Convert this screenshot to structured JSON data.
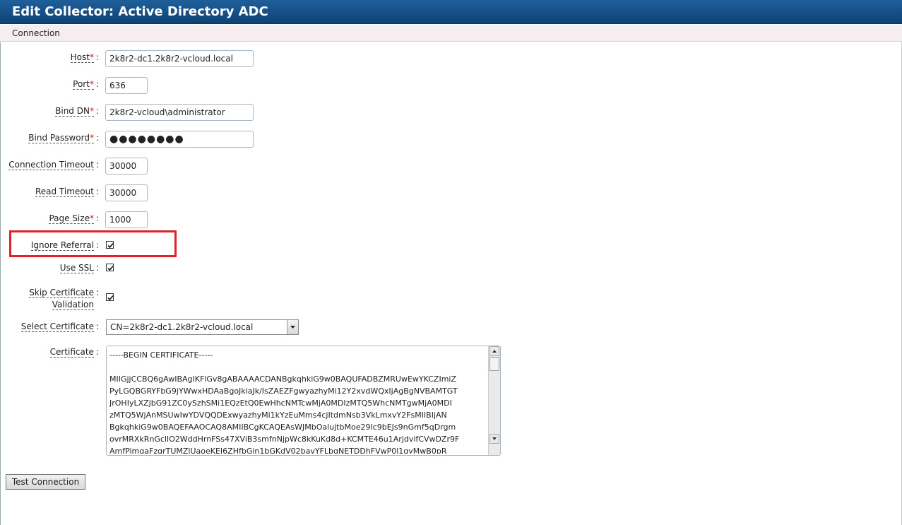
{
  "window": {
    "title": "Edit Collector: Active Directory ADC"
  },
  "tabs": [
    {
      "label": "Connection"
    }
  ],
  "form": {
    "host": {
      "label": "Host",
      "value": "2k8r2-dc1.2k8r2-vcloud.local"
    },
    "port": {
      "label": "Port",
      "value": "636"
    },
    "bind_dn": {
      "label": "Bind DN",
      "value": "2k8r2-vcloud\\administrator"
    },
    "bind_password": {
      "label": "Bind Password",
      "value": "●●●●●●●●"
    },
    "connection_timeout": {
      "label": "Connection Timeout",
      "value": "30000"
    },
    "read_timeout": {
      "label": "Read Timeout",
      "value": "30000"
    },
    "page_size": {
      "label": "Page Size",
      "value": "1000"
    },
    "ignore_referral": {
      "label": "Ignore Referral",
      "checked": true
    },
    "use_ssl": {
      "label": "Use SSL",
      "checked": true
    },
    "skip_cert_validation": {
      "label_line1": "Skip Certificate",
      "label_line2": "Validation",
      "checked": true
    },
    "select_certificate": {
      "label": "Select Certificate",
      "value": "CN=2k8r2-dc1.2k8r2-vcloud.local"
    },
    "certificate": {
      "label": "Certificate",
      "value": "-----BEGIN CERTIFICATE-----\n\nMIIGjjCCBQ6gAwIBAgIKFlGv8gABAAAACDANBgkqhkiG9w0BAQUFADBZMRUwEwYKCZImiZ\nPyLGQBGRYFbG9jYWwxHDAaBgoJkiaJk/IsZAEZFgwyazhyMi12Y2xvdWQxIjAgBgNVBAMTGT\nJrOHIyLXZjbG91ZC0ySzhSMi1EQzEtQ0EwHhcNMTcwMjA0MDIzMTQ5WhcNMTgwMjA0MDI\nzMTQ5WjAnMSUwIwYDVQQDExwyazhyMi1kYzEuMms4cjItdmNsb3VkLmxvY2FsMIIBIjAN\nBgkqhkiG9w0BAQEFAAOCAQ8AMIIBCgKCAQEAsWJMbOalujtbMoe29Ic9bEJs9nGmf5qDrgm\novrMRXkRnGcllO2WddHrnFSs47XViB3smfnNjpWc8kKuKd8d+KCMTE46u1ArjdvifCVwDZr9F\nAmfPimgaFzgrTUMZlUaoeKEI6ZHfbGin1bGKdV02bavYFLbgNETDDhFVwP0l1gyMwB0pR"
    }
  },
  "actions": {
    "test_connection": "Test Connection"
  }
}
